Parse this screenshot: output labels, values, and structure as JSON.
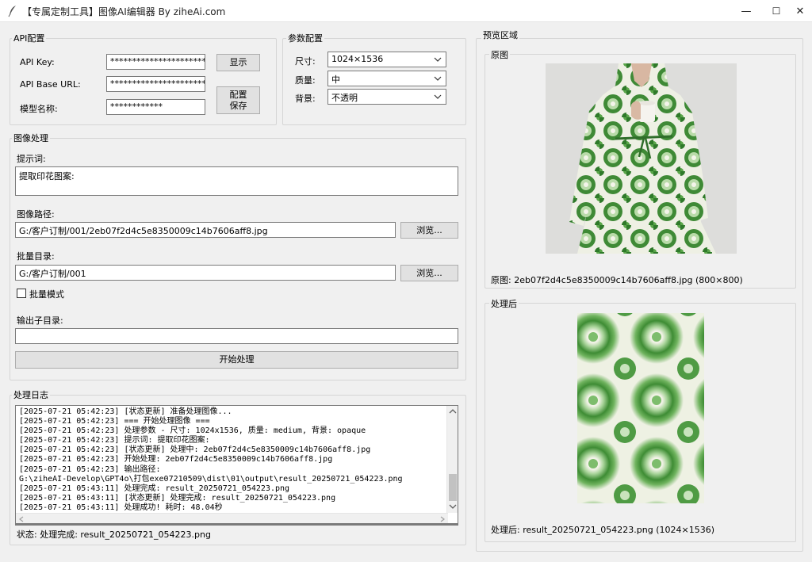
{
  "window": {
    "title": "【专属定制工具】图像AI编辑器 By ziheAi.com",
    "minimize_glyph": "—",
    "maximize_glyph": "☐",
    "close_glyph": "✕"
  },
  "api_config": {
    "group_label": "API配置",
    "api_key_label": "API Key:",
    "api_key_value": "****************************",
    "api_base_label": "API Base URL:",
    "api_base_value": "*************************",
    "model_label": "模型名称:",
    "model_value": "************",
    "show_button": "显示",
    "save_button": "配置\n保存"
  },
  "param_config": {
    "group_label": "参数配置",
    "size_label": "尺寸:",
    "size_value": "1024×1536",
    "quality_label": "质量:",
    "quality_value": "中",
    "background_label": "背景:",
    "background_value": "不透明"
  },
  "image_processing": {
    "group_label": "图像处理",
    "prompt_label": "提示词:",
    "prompt_value": "提取印花图案:",
    "image_path_label": "图像路径:",
    "image_path_value": "G:/客户订制/001/2eb07f2d4c5e8350009c14b7606aff8.jpg",
    "browse_button_1": "浏览...",
    "batch_dir_label": "批量目录:",
    "batch_dir_value": "G:/客户订制/001",
    "browse_button_2": "浏览...",
    "batch_mode_label": "批量模式",
    "batch_mode_checked": false,
    "output_subdir_label": "输出子目录:",
    "output_subdir_value": "",
    "start_button": "开始处理"
  },
  "log": {
    "group_label": "处理日志",
    "lines": [
      "[2025-07-21 05:42:23] [状态更新] 准备处理图像...",
      "[2025-07-21 05:42:23] === 开始处理图像 ===",
      "[2025-07-21 05:42:23] 处理参数 - 尺寸: 1024x1536, 质量: medium, 背景: opaque",
      "[2025-07-21 05:42:23] 提示词: 提取印花图案:",
      "[2025-07-21 05:42:23] [状态更新] 处理中: 2eb07f2d4c5e8350009c14b7606aff8.jpg",
      "[2025-07-21 05:42:23] 开始处理: 2eb07f2d4c5e8350009c14b7606aff8.jpg",
      "[2025-07-21 05:42:23] 输出路径:",
      "G:\\ziheAI-Develop\\GPT4o\\打包exe07210509\\dist\\01\\output\\result_20250721_054223.png",
      "[2025-07-21 05:43:11] 处理完成: result_20250721_054223.png",
      "[2025-07-21 05:43:11] [状态更新] 处理完成: result_20250721_054223.png",
      "[2025-07-21 05:43:11] 处理成功! 耗时: 48.04秒"
    ],
    "status": "状态: 处理完成: result_20250721_054223.png"
  },
  "preview": {
    "group_label": "预览区域",
    "original_label": "原图",
    "original_caption": "原图: 2eb07f2d4c5e8350009c14b7606aff8.jpg (800×800)",
    "processed_label": "处理后",
    "processed_caption": "处理后: result_20250721_054223.png (1024×1536)"
  },
  "colors": {
    "green_dark": "#2f7a2a",
    "green_mid": "#5aa64a",
    "green_light": "#a9d49a",
    "cream": "#f2f1e6",
    "backdrop": "#d9d8d6"
  }
}
